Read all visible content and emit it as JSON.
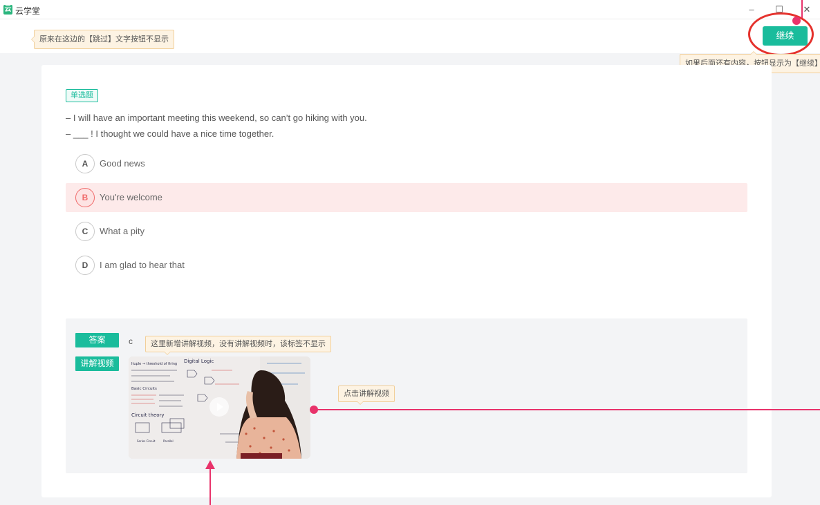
{
  "window": {
    "app_logo": "云",
    "app_title": "云学堂",
    "minimize": "–",
    "maximize": "☐",
    "close": "✕"
  },
  "header": {
    "skip_note": "原来在这边的【跳过】文字按钮不显示",
    "continue_label": "继续",
    "continue_note": "如果后面还有内容，按钮显示为【继续】"
  },
  "question": {
    "type_label": "单选题",
    "line1": "– I will have an important meeting this weekend, so can’t go hiking with you.",
    "line2": "– ___ ! I thought we could have a nice time together.",
    "options": [
      {
        "letter": "A",
        "text": "Good news"
      },
      {
        "letter": "B",
        "text": "You're welcome"
      },
      {
        "letter": "C",
        "text": "What a pity"
      },
      {
        "letter": "D",
        "text": " I am glad to hear that"
      }
    ],
    "selected": "B"
  },
  "analysis": {
    "answer_label": "答案",
    "answer_value": "c",
    "video_label": "讲解视频",
    "video_tag_note": "这里新增讲解视频，没有讲解视频时，该标签不显示",
    "video_click_note": "点击讲解视频"
  },
  "whiteboard": {
    "line_a": "Ituple → threshold of firing",
    "line_b": "Digital Logic",
    "line_c": "Basic Circuits",
    "line_d": "Circuit theory",
    "line_e": "Series Circuit",
    "line_f": "Parallel"
  },
  "colors": {
    "accent": "#1abc9c",
    "wrong_bg": "#fdeaea",
    "wrong_border": "#f06b6b",
    "annotation_red": "#e5322d",
    "annotation_pink": "#e8336b",
    "note_bg": "#fdf3e3"
  }
}
